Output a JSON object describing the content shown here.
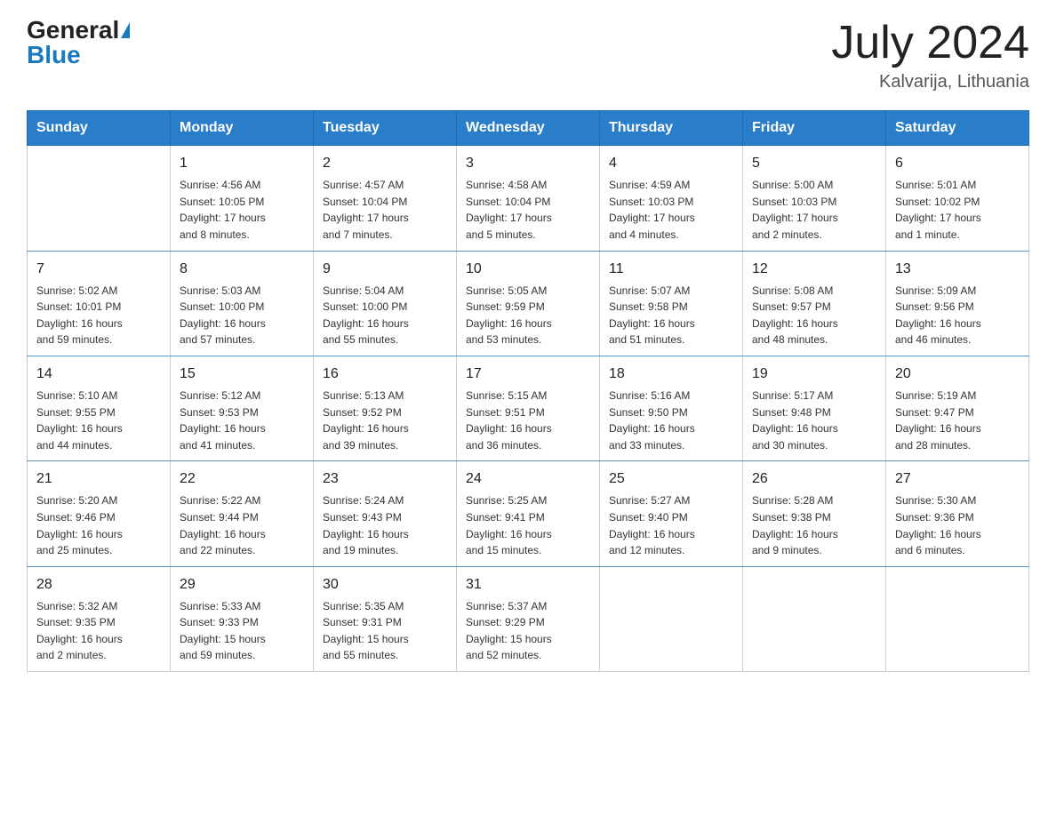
{
  "header": {
    "logo_general": "General",
    "logo_blue": "Blue",
    "month_title": "July 2024",
    "location": "Kalvarija, Lithuania"
  },
  "weekdays": [
    "Sunday",
    "Monday",
    "Tuesday",
    "Wednesday",
    "Thursday",
    "Friday",
    "Saturday"
  ],
  "weeks": [
    [
      {
        "day": "",
        "info": ""
      },
      {
        "day": "1",
        "info": "Sunrise: 4:56 AM\nSunset: 10:05 PM\nDaylight: 17 hours\nand 8 minutes."
      },
      {
        "day": "2",
        "info": "Sunrise: 4:57 AM\nSunset: 10:04 PM\nDaylight: 17 hours\nand 7 minutes."
      },
      {
        "day": "3",
        "info": "Sunrise: 4:58 AM\nSunset: 10:04 PM\nDaylight: 17 hours\nand 5 minutes."
      },
      {
        "day": "4",
        "info": "Sunrise: 4:59 AM\nSunset: 10:03 PM\nDaylight: 17 hours\nand 4 minutes."
      },
      {
        "day": "5",
        "info": "Sunrise: 5:00 AM\nSunset: 10:03 PM\nDaylight: 17 hours\nand 2 minutes."
      },
      {
        "day": "6",
        "info": "Sunrise: 5:01 AM\nSunset: 10:02 PM\nDaylight: 17 hours\nand 1 minute."
      }
    ],
    [
      {
        "day": "7",
        "info": "Sunrise: 5:02 AM\nSunset: 10:01 PM\nDaylight: 16 hours\nand 59 minutes."
      },
      {
        "day": "8",
        "info": "Sunrise: 5:03 AM\nSunset: 10:00 PM\nDaylight: 16 hours\nand 57 minutes."
      },
      {
        "day": "9",
        "info": "Sunrise: 5:04 AM\nSunset: 10:00 PM\nDaylight: 16 hours\nand 55 minutes."
      },
      {
        "day": "10",
        "info": "Sunrise: 5:05 AM\nSunset: 9:59 PM\nDaylight: 16 hours\nand 53 minutes."
      },
      {
        "day": "11",
        "info": "Sunrise: 5:07 AM\nSunset: 9:58 PM\nDaylight: 16 hours\nand 51 minutes."
      },
      {
        "day": "12",
        "info": "Sunrise: 5:08 AM\nSunset: 9:57 PM\nDaylight: 16 hours\nand 48 minutes."
      },
      {
        "day": "13",
        "info": "Sunrise: 5:09 AM\nSunset: 9:56 PM\nDaylight: 16 hours\nand 46 minutes."
      }
    ],
    [
      {
        "day": "14",
        "info": "Sunrise: 5:10 AM\nSunset: 9:55 PM\nDaylight: 16 hours\nand 44 minutes."
      },
      {
        "day": "15",
        "info": "Sunrise: 5:12 AM\nSunset: 9:53 PM\nDaylight: 16 hours\nand 41 minutes."
      },
      {
        "day": "16",
        "info": "Sunrise: 5:13 AM\nSunset: 9:52 PM\nDaylight: 16 hours\nand 39 minutes."
      },
      {
        "day": "17",
        "info": "Sunrise: 5:15 AM\nSunset: 9:51 PM\nDaylight: 16 hours\nand 36 minutes."
      },
      {
        "day": "18",
        "info": "Sunrise: 5:16 AM\nSunset: 9:50 PM\nDaylight: 16 hours\nand 33 minutes."
      },
      {
        "day": "19",
        "info": "Sunrise: 5:17 AM\nSunset: 9:48 PM\nDaylight: 16 hours\nand 30 minutes."
      },
      {
        "day": "20",
        "info": "Sunrise: 5:19 AM\nSunset: 9:47 PM\nDaylight: 16 hours\nand 28 minutes."
      }
    ],
    [
      {
        "day": "21",
        "info": "Sunrise: 5:20 AM\nSunset: 9:46 PM\nDaylight: 16 hours\nand 25 minutes."
      },
      {
        "day": "22",
        "info": "Sunrise: 5:22 AM\nSunset: 9:44 PM\nDaylight: 16 hours\nand 22 minutes."
      },
      {
        "day": "23",
        "info": "Sunrise: 5:24 AM\nSunset: 9:43 PM\nDaylight: 16 hours\nand 19 minutes."
      },
      {
        "day": "24",
        "info": "Sunrise: 5:25 AM\nSunset: 9:41 PM\nDaylight: 16 hours\nand 15 minutes."
      },
      {
        "day": "25",
        "info": "Sunrise: 5:27 AM\nSunset: 9:40 PM\nDaylight: 16 hours\nand 12 minutes."
      },
      {
        "day": "26",
        "info": "Sunrise: 5:28 AM\nSunset: 9:38 PM\nDaylight: 16 hours\nand 9 minutes."
      },
      {
        "day": "27",
        "info": "Sunrise: 5:30 AM\nSunset: 9:36 PM\nDaylight: 16 hours\nand 6 minutes."
      }
    ],
    [
      {
        "day": "28",
        "info": "Sunrise: 5:32 AM\nSunset: 9:35 PM\nDaylight: 16 hours\nand 2 minutes."
      },
      {
        "day": "29",
        "info": "Sunrise: 5:33 AM\nSunset: 9:33 PM\nDaylight: 15 hours\nand 59 minutes."
      },
      {
        "day": "30",
        "info": "Sunrise: 5:35 AM\nSunset: 9:31 PM\nDaylight: 15 hours\nand 55 minutes."
      },
      {
        "day": "31",
        "info": "Sunrise: 5:37 AM\nSunset: 9:29 PM\nDaylight: 15 hours\nand 52 minutes."
      },
      {
        "day": "",
        "info": ""
      },
      {
        "day": "",
        "info": ""
      },
      {
        "day": "",
        "info": ""
      }
    ]
  ]
}
